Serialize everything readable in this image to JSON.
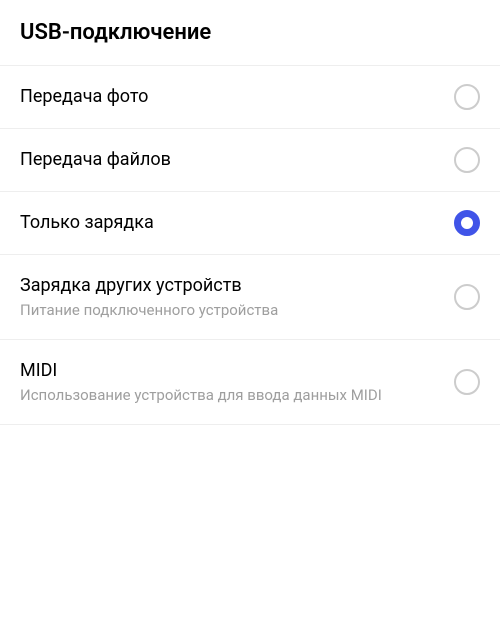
{
  "header": {
    "title": "USB-подключение"
  },
  "options": [
    {
      "label": "Передача фото",
      "sublabel": "",
      "selected": false
    },
    {
      "label": "Передача файлов",
      "sublabel": "",
      "selected": false
    },
    {
      "label": "Только зарядка",
      "sublabel": "",
      "selected": true
    },
    {
      "label": "Зарядка других устройств",
      "sublabel": "Питание подключенного устройства",
      "selected": false
    },
    {
      "label": "MIDI",
      "sublabel": "Использование устройства для ввода данных MIDI",
      "selected": false
    }
  ]
}
